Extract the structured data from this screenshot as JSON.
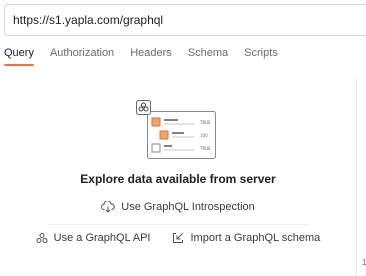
{
  "url_bar": {
    "value": "https://s1.yapla.com/graphql"
  },
  "tabs": [
    {
      "label": "Query",
      "active": true
    },
    {
      "label": "Authorization"
    },
    {
      "label": "Headers"
    },
    {
      "label": "Schema"
    },
    {
      "label": "Scripts"
    }
  ],
  "empty_state": {
    "heading": "Explore data available from server",
    "introspection_label": "Use GraphQL Introspection",
    "api_label": "Use a GraphQL API",
    "import_label": "Import a GraphQL schema",
    "illustration_labels": [
      "TRUE",
      "100",
      "TRUE"
    ]
  },
  "side_panel": {
    "marker": "1"
  },
  "colors": {
    "accent": "#ff6c37",
    "text": "#212121",
    "muted": "#6b6b6b",
    "border": "#d6d6d6"
  },
  "icons": {
    "illustration": "graphql-query-illustration-icon",
    "introspection": "cloud-download-icon",
    "api": "graphql-icon",
    "import": "import-icon"
  }
}
